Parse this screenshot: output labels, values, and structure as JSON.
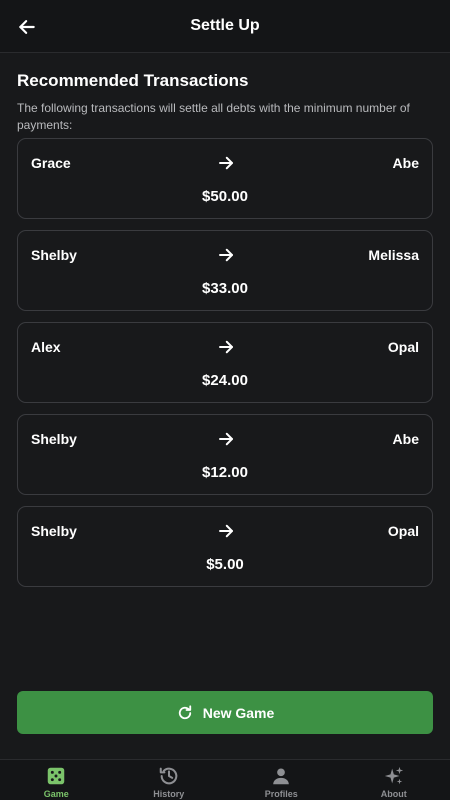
{
  "header": {
    "title": "Settle Up",
    "back_icon": "arrow-left-icon"
  },
  "main": {
    "section_title": "Recommended Transactions",
    "description": "The following transactions will settle all debts with the minimum number of payments:",
    "transactions": [
      {
        "from": "Grace",
        "to": "Abe",
        "amount": "$50.00"
      },
      {
        "from": "Shelby",
        "to": "Melissa",
        "amount": "$33.00"
      },
      {
        "from": "Alex",
        "to": "Opal",
        "amount": "$24.00"
      },
      {
        "from": "Shelby",
        "to": "Abe",
        "amount": "$12.00"
      },
      {
        "from": "Shelby",
        "to": "Opal",
        "amount": "$5.00"
      }
    ]
  },
  "new_game_button": {
    "label": "New Game",
    "icon": "refresh-icon",
    "color": "#3d9144"
  },
  "bottom_nav": {
    "active_color": "#7bc36a",
    "items": [
      {
        "label": "Game",
        "icon": "dice-icon",
        "active": true
      },
      {
        "label": "History",
        "icon": "history-icon",
        "active": false
      },
      {
        "label": "Profiles",
        "icon": "person-icon",
        "active": false
      },
      {
        "label": "About",
        "icon": "sparkles-icon",
        "active": false
      }
    ]
  }
}
